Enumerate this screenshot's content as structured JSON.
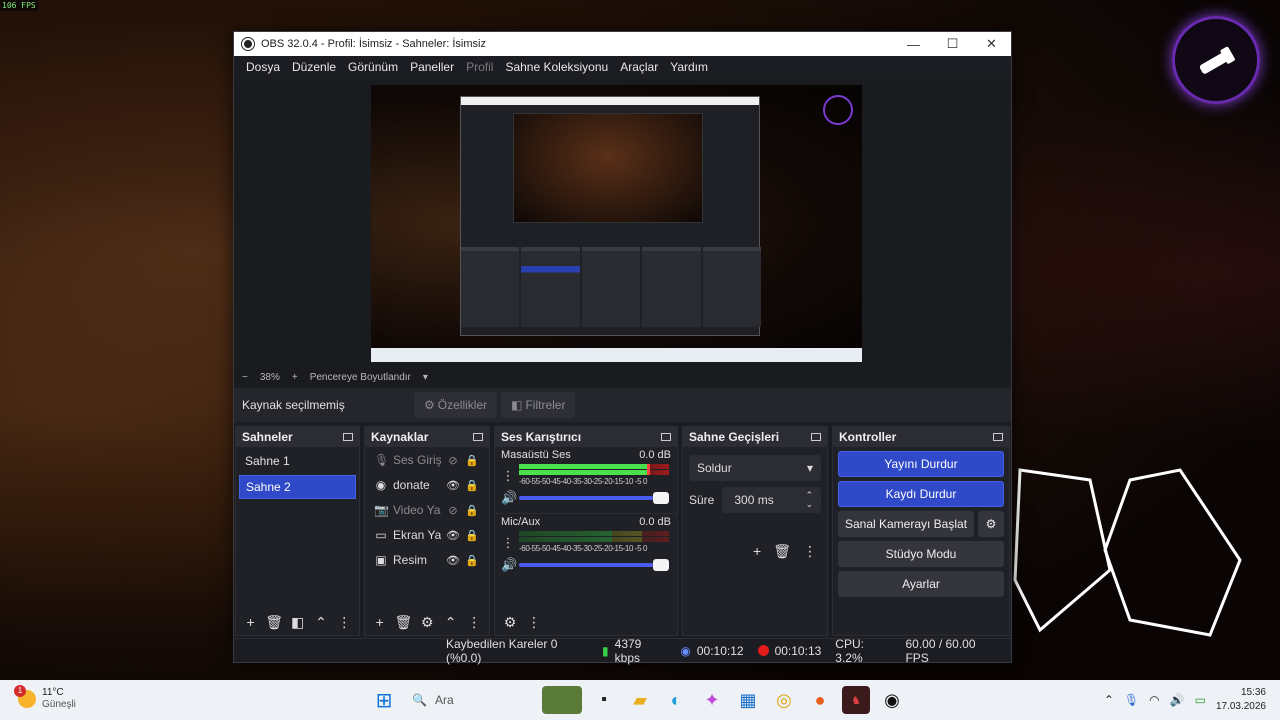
{
  "overlay": {
    "fps": "106 FPS"
  },
  "window": {
    "title": "OBS 32.0.4 - Profil: İsimsiz - Sahneler: İsimsiz",
    "controls": {
      "minimize": "—",
      "maximize": "☐",
      "close": "✕"
    }
  },
  "menu": [
    "Dosya",
    "Düzenle",
    "Görünüm",
    "Paneller",
    "Profil",
    "Sahne Koleksiyonu",
    "Araçlar",
    "Yardım"
  ],
  "zoom": {
    "minus": "−",
    "value": "38%",
    "plus": "+",
    "fit_label": "Pencereye Boyutlandır"
  },
  "context": {
    "no_selection": "Kaynak seçilmemiş",
    "properties_label": "Özellikler",
    "filters_label": "Filtreler"
  },
  "scenes": {
    "title": "Sahneler",
    "items": [
      "Sahne 1",
      "Sahne 2"
    ],
    "active_index": 1
  },
  "sources": {
    "title": "Kaynaklar",
    "items": [
      {
        "label": "Ses Giriş Yakalama",
        "icon": "mic-icon",
        "visible": false
      },
      {
        "label": "donate",
        "icon": "browser-icon",
        "visible": true
      },
      {
        "label": "Video Yakalama",
        "icon": "camera-icon",
        "visible": false
      },
      {
        "label": "Ekran Yakalama",
        "icon": "display-icon",
        "visible": true
      },
      {
        "label": "Resim",
        "icon": "image-icon",
        "visible": true
      }
    ]
  },
  "mixer": {
    "title": "Ses Karıştırıcı",
    "channels": [
      {
        "name": "Masaüstü Ses",
        "db": "0.0 dB",
        "level": 0.85,
        "volume": 1.0
      },
      {
        "name": "Mic/Aux",
        "db": "0.0 dB",
        "level": 0.0,
        "volume": 1.0
      }
    ],
    "ticks": "-60-55-50-45-40-35-30-25-20-15-10 -5  0"
  },
  "transitions": {
    "title": "Sahne Geçişleri",
    "selected": "Soldur",
    "duration_label": "Süre",
    "duration_value": "300 ms"
  },
  "controls": {
    "title": "Kontroller",
    "stop_stream": "Yayını Durdur",
    "stop_record": "Kaydı Durdur",
    "virtual_cam": "Sanal Kamerayı Başlat",
    "studio_mode": "Stüdyo Modu",
    "settings": "Ayarlar"
  },
  "status": {
    "dropped_frames": "Kaybedilen Kareler 0 (%0.0)",
    "bitrate": "4379 kbps",
    "stream_time": "00:10:12",
    "record_time": "00:10:13",
    "cpu": "CPU: 3.2%",
    "fps": "60.00 / 60.00 FPS"
  },
  "taskbar": {
    "weather_badge": "1",
    "temperature": "11°C",
    "condition": "Güneşli",
    "search_placeholder": "Ara",
    "time": "15:36",
    "date": "17.03.2026"
  },
  "colors": {
    "accent": "#2f49c8",
    "record": "#e31b1b",
    "meter_green": "#4ae04e"
  }
}
